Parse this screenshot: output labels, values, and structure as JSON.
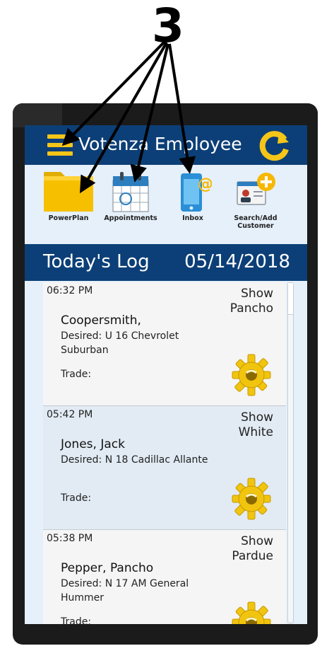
{
  "callout": {
    "number": "3"
  },
  "app": {
    "title": "Votenza Employee"
  },
  "toolbar": {
    "items": [
      {
        "label": "PowerPlan",
        "icon": "folder-icon"
      },
      {
        "label": "Appointments",
        "icon": "calendar-icon"
      },
      {
        "label": "Inbox",
        "icon": "mobile-email-icon"
      },
      {
        "label": "Search/Add Customer",
        "icon": "add-customer-icon"
      }
    ]
  },
  "log": {
    "title": "Today's Log",
    "date": "05/14/2018",
    "entries": [
      {
        "time": "06:32 PM",
        "status": "Show Pancho",
        "name": "Coopersmith,",
        "desired": "Desired: U  16 Chevrolet Suburban",
        "trade": "Trade:"
      },
      {
        "time": "05:42 PM",
        "status": "Show White",
        "name": "Jones, Jack",
        "desired": "Desired: N  18 Cadillac Allante",
        "trade": "Trade:"
      },
      {
        "time": "05:38 PM",
        "status": "Show Pardue",
        "name": "Pepper, Pancho",
        "desired": "Desired: N  17 AM General Hummer",
        "trade": "Trade:"
      }
    ]
  },
  "colors": {
    "header": "#0c3f77",
    "accent": "#f5c518",
    "screen_background": "#e6f0fa"
  }
}
